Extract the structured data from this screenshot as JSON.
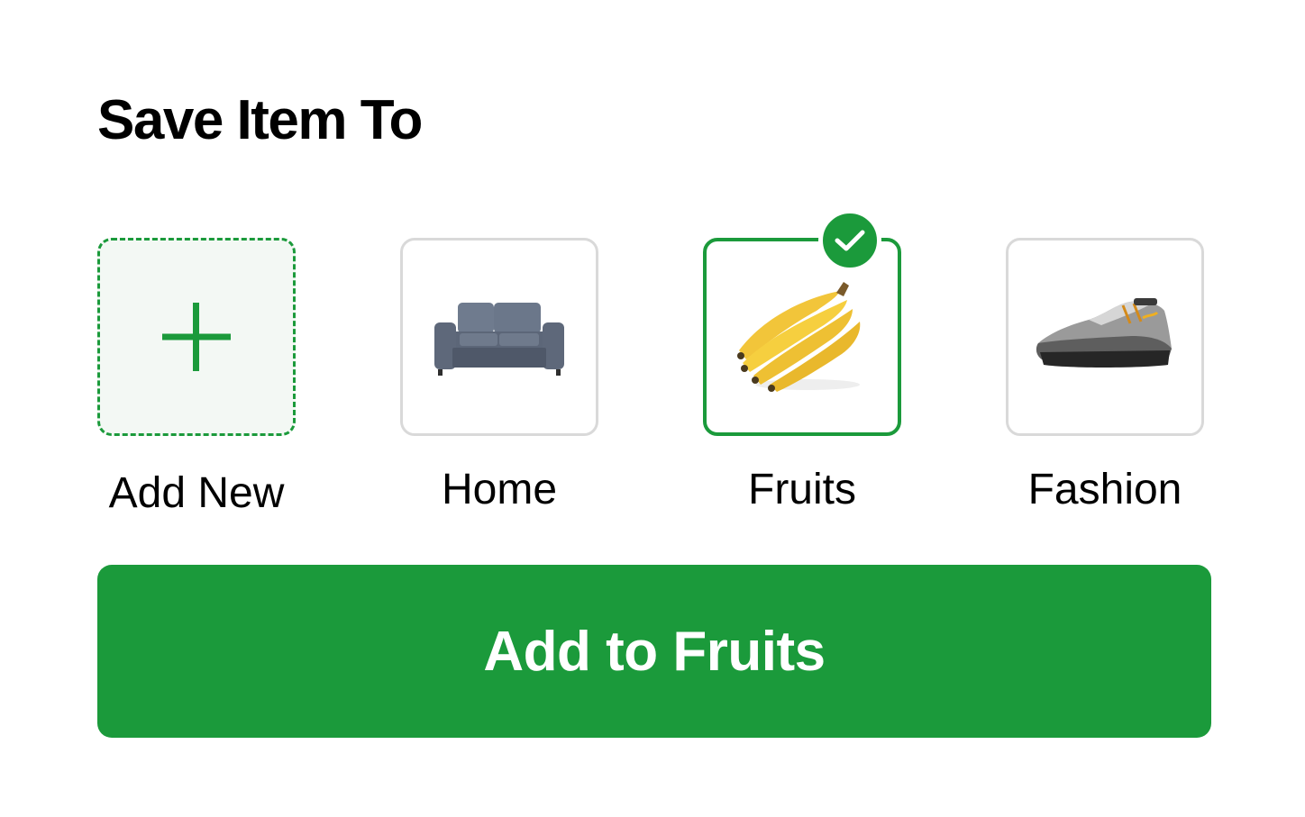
{
  "header": {
    "title": "Save Item To"
  },
  "collections": [
    {
      "label": "Add New",
      "icon": "plus-icon",
      "type": "add"
    },
    {
      "label": "Home",
      "icon": "sofa-image"
    },
    {
      "label": "Fruits",
      "icon": "banana-image",
      "selected": true
    },
    {
      "label": "Fashion",
      "icon": "sneaker-image"
    }
  ],
  "cta": {
    "label": "Add to Fruits"
  },
  "colors": {
    "accent": "#1b9a3b",
    "tile_border": "#d9d9d9",
    "add_tile_bg": "#f3f8f4"
  }
}
